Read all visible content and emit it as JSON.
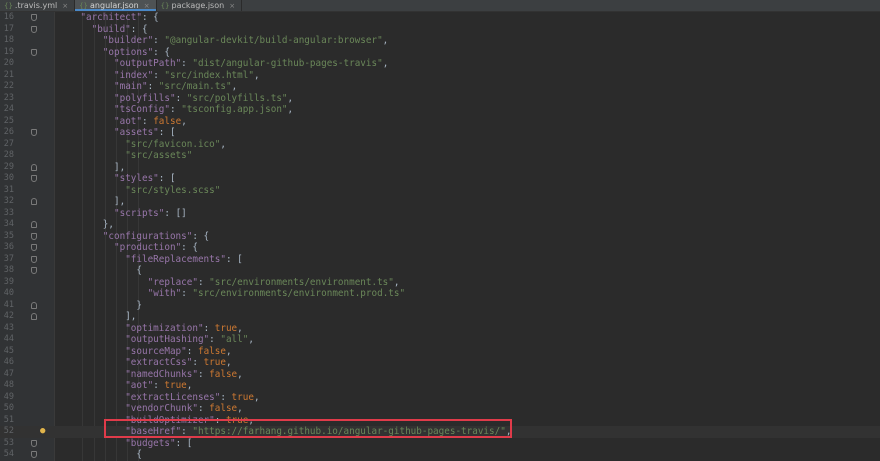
{
  "tabs": [
    {
      "label": ".travis.yml",
      "active": false,
      "icon": "yaml-file-icon"
    },
    {
      "label": "angular.json",
      "active": true,
      "icon": "json-file-icon"
    },
    {
      "label": "package.json",
      "active": false,
      "icon": "json-file-icon"
    }
  ],
  "colors": {
    "background": "#2b2b2b",
    "key": "#9876aa",
    "string": "#6a8759",
    "keyword": "#cc7832",
    "highlight_box": "#e03b4a"
  },
  "highlighted_line": 52,
  "lines": [
    {
      "n": "16",
      "indent": 2,
      "fold": "open",
      "tokens": [
        [
          "k",
          "\"architect\""
        ],
        [
          "p",
          ": {"
        ]
      ]
    },
    {
      "n": "17",
      "indent": 3,
      "fold": "open",
      "tokens": [
        [
          "k",
          "\"build\""
        ],
        [
          "p",
          ": {"
        ]
      ]
    },
    {
      "n": "18",
      "indent": 4,
      "tokens": [
        [
          "k",
          "\"builder\""
        ],
        [
          "p",
          ": "
        ],
        [
          "s",
          "\"@angular-devkit/build-angular:browser\""
        ],
        [
          "p",
          ","
        ]
      ]
    },
    {
      "n": "19",
      "indent": 4,
      "fold": "open",
      "tokens": [
        [
          "k",
          "\"options\""
        ],
        [
          "p",
          ": {"
        ]
      ]
    },
    {
      "n": "20",
      "indent": 5,
      "tokens": [
        [
          "k",
          "\"outputPath\""
        ],
        [
          "p",
          ": "
        ],
        [
          "s",
          "\"dist/angular-github-pages-travis\""
        ],
        [
          "p",
          ","
        ]
      ]
    },
    {
      "n": "21",
      "indent": 5,
      "tokens": [
        [
          "k",
          "\"index\""
        ],
        [
          "p",
          ": "
        ],
        [
          "s",
          "\"src/index.html\""
        ],
        [
          "p",
          ","
        ]
      ]
    },
    {
      "n": "22",
      "indent": 5,
      "tokens": [
        [
          "k",
          "\"main\""
        ],
        [
          "p",
          ": "
        ],
        [
          "s",
          "\"src/main.ts\""
        ],
        [
          "p",
          ","
        ]
      ]
    },
    {
      "n": "23",
      "indent": 5,
      "tokens": [
        [
          "k",
          "\"polyfills\""
        ],
        [
          "p",
          ": "
        ],
        [
          "s",
          "\"src/polyfills.ts\""
        ],
        [
          "p",
          ","
        ]
      ]
    },
    {
      "n": "24",
      "indent": 5,
      "tokens": [
        [
          "k",
          "\"tsConfig\""
        ],
        [
          "p",
          ": "
        ],
        [
          "s",
          "\"tsconfig.app.json\""
        ],
        [
          "p",
          ","
        ]
      ]
    },
    {
      "n": "25",
      "indent": 5,
      "tokens": [
        [
          "k",
          "\"aot\""
        ],
        [
          "p",
          ": "
        ],
        [
          "b",
          "false"
        ],
        [
          "p",
          ","
        ]
      ]
    },
    {
      "n": "26",
      "indent": 5,
      "fold": "open",
      "tokens": [
        [
          "k",
          "\"assets\""
        ],
        [
          "p",
          ": ["
        ]
      ]
    },
    {
      "n": "27",
      "indent": 6,
      "tokens": [
        [
          "s",
          "\"src/favicon.ico\""
        ],
        [
          "p",
          ","
        ]
      ]
    },
    {
      "n": "28",
      "indent": 6,
      "tokens": [
        [
          "s",
          "\"src/assets\""
        ]
      ]
    },
    {
      "n": "29",
      "indent": 5,
      "fold": "close",
      "tokens": [
        [
          "p",
          "],"
        ]
      ]
    },
    {
      "n": "30",
      "indent": 5,
      "fold": "open",
      "tokens": [
        [
          "k",
          "\"styles\""
        ],
        [
          "p",
          ": ["
        ]
      ]
    },
    {
      "n": "31",
      "indent": 6,
      "tokens": [
        [
          "s",
          "\"src/styles.scss\""
        ]
      ]
    },
    {
      "n": "32",
      "indent": 5,
      "fold": "close",
      "tokens": [
        [
          "p",
          "],"
        ]
      ]
    },
    {
      "n": "33",
      "indent": 5,
      "tokens": [
        [
          "k",
          "\"scripts\""
        ],
        [
          "p",
          ": []"
        ]
      ]
    },
    {
      "n": "34",
      "indent": 4,
      "fold": "close",
      "tokens": [
        [
          "p",
          "},"
        ]
      ]
    },
    {
      "n": "35",
      "indent": 4,
      "fold": "open",
      "tokens": [
        [
          "k",
          "\"configurations\""
        ],
        [
          "p",
          ": {"
        ]
      ]
    },
    {
      "n": "36",
      "indent": 5,
      "fold": "open",
      "tokens": [
        [
          "k",
          "\"production\""
        ],
        [
          "p",
          ": {"
        ]
      ]
    },
    {
      "n": "37",
      "indent": 6,
      "fold": "open",
      "tokens": [
        [
          "k",
          "\"fileReplacements\""
        ],
        [
          "p",
          ": ["
        ]
      ]
    },
    {
      "n": "38",
      "indent": 7,
      "fold": "open",
      "tokens": [
        [
          "p",
          "{"
        ]
      ]
    },
    {
      "n": "39",
      "indent": 8,
      "tokens": [
        [
          "k",
          "\"replace\""
        ],
        [
          "p",
          ": "
        ],
        [
          "s",
          "\"src/environments/environment.ts\""
        ],
        [
          "p",
          ","
        ]
      ]
    },
    {
      "n": "40",
      "indent": 8,
      "tokens": [
        [
          "k",
          "\"with\""
        ],
        [
          "p",
          ": "
        ],
        [
          "s",
          "\"src/environments/environment.prod.ts\""
        ]
      ]
    },
    {
      "n": "41",
      "indent": 7,
      "fold": "close",
      "tokens": [
        [
          "p",
          "}"
        ]
      ]
    },
    {
      "n": "42",
      "indent": 6,
      "fold": "close",
      "tokens": [
        [
          "p",
          "],"
        ]
      ]
    },
    {
      "n": "43",
      "indent": 6,
      "tokens": [
        [
          "k",
          "\"optimization\""
        ],
        [
          "p",
          ": "
        ],
        [
          "b",
          "true"
        ],
        [
          "p",
          ","
        ]
      ]
    },
    {
      "n": "44",
      "indent": 6,
      "tokens": [
        [
          "k",
          "\"outputHashing\""
        ],
        [
          "p",
          ": "
        ],
        [
          "s",
          "\"all\""
        ],
        [
          "p",
          ","
        ]
      ]
    },
    {
      "n": "45",
      "indent": 6,
      "tokens": [
        [
          "k",
          "\"sourceMap\""
        ],
        [
          "p",
          ": "
        ],
        [
          "b",
          "false"
        ],
        [
          "p",
          ","
        ]
      ]
    },
    {
      "n": "46",
      "indent": 6,
      "tokens": [
        [
          "k",
          "\"extractCss\""
        ],
        [
          "p",
          ": "
        ],
        [
          "b",
          "true"
        ],
        [
          "p",
          ","
        ]
      ]
    },
    {
      "n": "47",
      "indent": 6,
      "tokens": [
        [
          "k",
          "\"namedChunks\""
        ],
        [
          "p",
          ": "
        ],
        [
          "b",
          "false"
        ],
        [
          "p",
          ","
        ]
      ]
    },
    {
      "n": "48",
      "indent": 6,
      "tokens": [
        [
          "k",
          "\"aot\""
        ],
        [
          "p",
          ": "
        ],
        [
          "b",
          "true"
        ],
        [
          "p",
          ","
        ]
      ]
    },
    {
      "n": "49",
      "indent": 6,
      "tokens": [
        [
          "k",
          "\"extractLicenses\""
        ],
        [
          "p",
          ": "
        ],
        [
          "b",
          "true"
        ],
        [
          "p",
          ","
        ]
      ]
    },
    {
      "n": "50",
      "indent": 6,
      "tokens": [
        [
          "k",
          "\"vendorChunk\""
        ],
        [
          "p",
          ": "
        ],
        [
          "b",
          "false"
        ],
        [
          "p",
          ","
        ]
      ]
    },
    {
      "n": "51",
      "indent": 6,
      "tokens": [
        [
          "k",
          "\"buildOptimizer\""
        ],
        [
          "p",
          ": "
        ],
        [
          "b",
          "true"
        ],
        [
          "p",
          ","
        ]
      ]
    },
    {
      "n": "52",
      "indent": 6,
      "bulb": true,
      "tokens": [
        [
          "k",
          "\"baseHref\""
        ],
        [
          "p",
          ": "
        ],
        [
          "s",
          "\"https://farhang.github.io/angular-github-pages-travis/\""
        ],
        [
          "p",
          ","
        ]
      ]
    },
    {
      "n": "53",
      "indent": 6,
      "fold": "open",
      "tokens": [
        [
          "k",
          "\"budgets\""
        ],
        [
          "p",
          ": ["
        ]
      ]
    },
    {
      "n": "54",
      "indent": 7,
      "fold": "open",
      "tokens": [
        [
          "p",
          "{"
        ]
      ]
    }
  ]
}
